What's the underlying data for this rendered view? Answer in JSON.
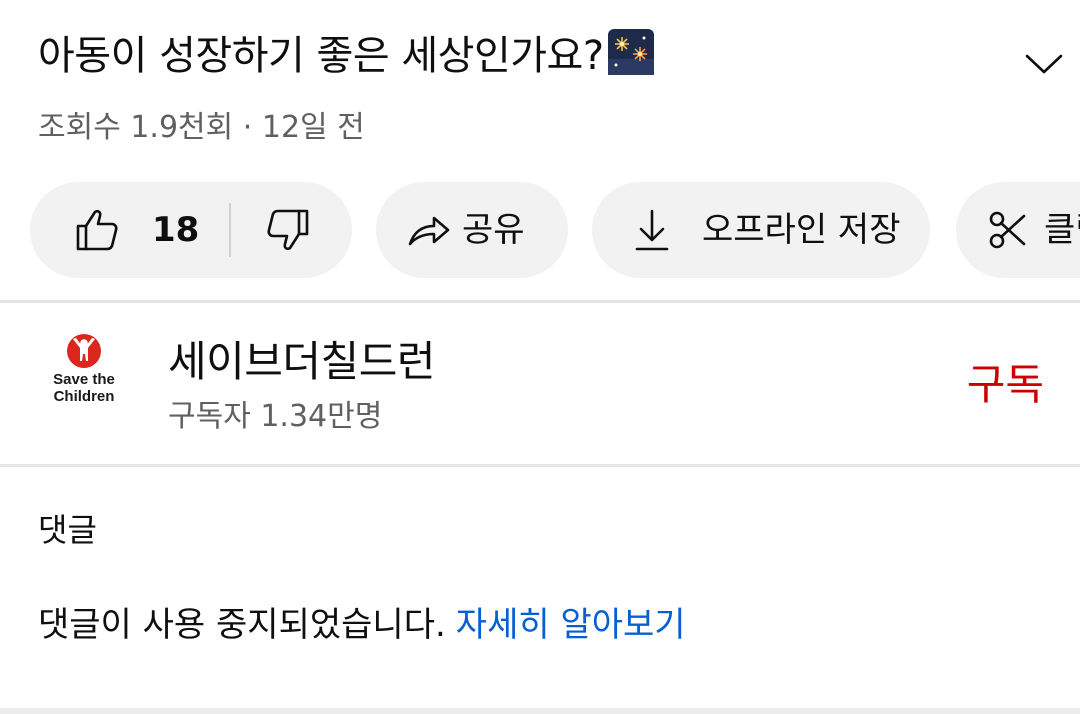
{
  "video": {
    "title": "아동이 성장하기 좋은 세상인가요?",
    "title_emoji": "fireworks-icon",
    "meta": "조회수 1.9천회 · 12일 전"
  },
  "actions": {
    "like_count": "18",
    "share_label": "공유",
    "download_label": "오프라인 저장",
    "clip_label": "클립"
  },
  "channel": {
    "name": "세이브더칠드런",
    "subscribers": "구독자 1.34만명",
    "logo_line1": "Save the",
    "logo_line2": "Children",
    "subscribe_label": "구독",
    "brand_color": "#cc0000"
  },
  "comments": {
    "heading": "댓글",
    "disabled_text": "댓글이 사용 중지되었습니다.",
    "learn_more": "자세히 알아보기",
    "link_color": "#065fd4"
  }
}
